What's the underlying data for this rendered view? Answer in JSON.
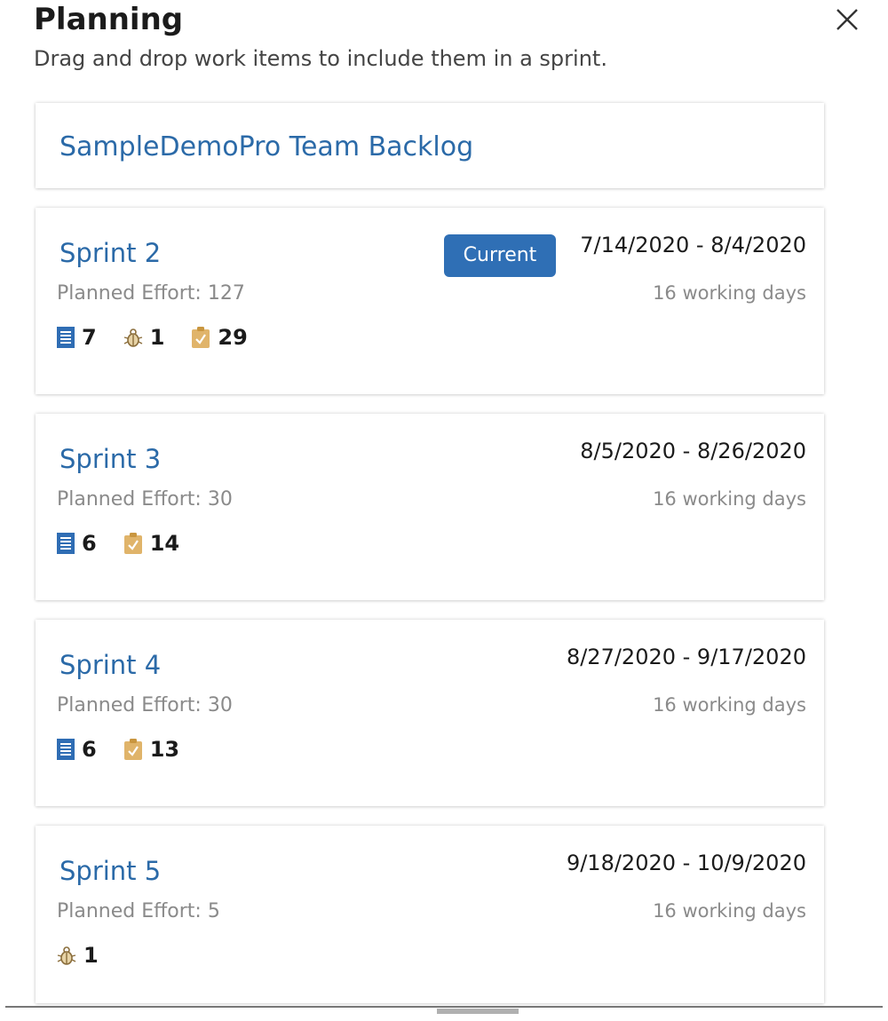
{
  "panel": {
    "title": "Planning",
    "subtitle": "Drag and drop work items to include them in a sprint."
  },
  "icons": {
    "close": "close-icon",
    "story": "user-story-icon",
    "bug": "bug-icon",
    "task": "task-icon"
  },
  "colors": {
    "link": "#2b6aa8",
    "badge": "#2f6fb5",
    "story_icon": "#2f6db4",
    "task_icon": "#e0b46a",
    "bug_icon": "#8a6d3b"
  },
  "backlog": {
    "title": "SampleDemoPro Team Backlog"
  },
  "sprints": [
    {
      "name": "Sprint 2",
      "effort": "Planned Effort: 127",
      "badge": "Current",
      "dates": "7/14/2020 - 8/4/2020",
      "working_days": "16 working days",
      "counts": {
        "story": "7",
        "bug": "1",
        "task": "29"
      }
    },
    {
      "name": "Sprint 3",
      "effort": "Planned Effort: 30",
      "dates": "8/5/2020 - 8/26/2020",
      "working_days": "16 working days",
      "counts": {
        "story": "6",
        "task": "14"
      }
    },
    {
      "name": "Sprint 4",
      "effort": "Planned Effort: 30",
      "dates": "8/27/2020 - 9/17/2020",
      "working_days": "16 working days",
      "counts": {
        "story": "6",
        "task": "13"
      }
    },
    {
      "name": "Sprint 5",
      "effort": "Planned Effort: 5",
      "dates": "9/18/2020 - 10/9/2020",
      "working_days": "16 working days",
      "counts": {
        "bug": "1"
      }
    }
  ]
}
